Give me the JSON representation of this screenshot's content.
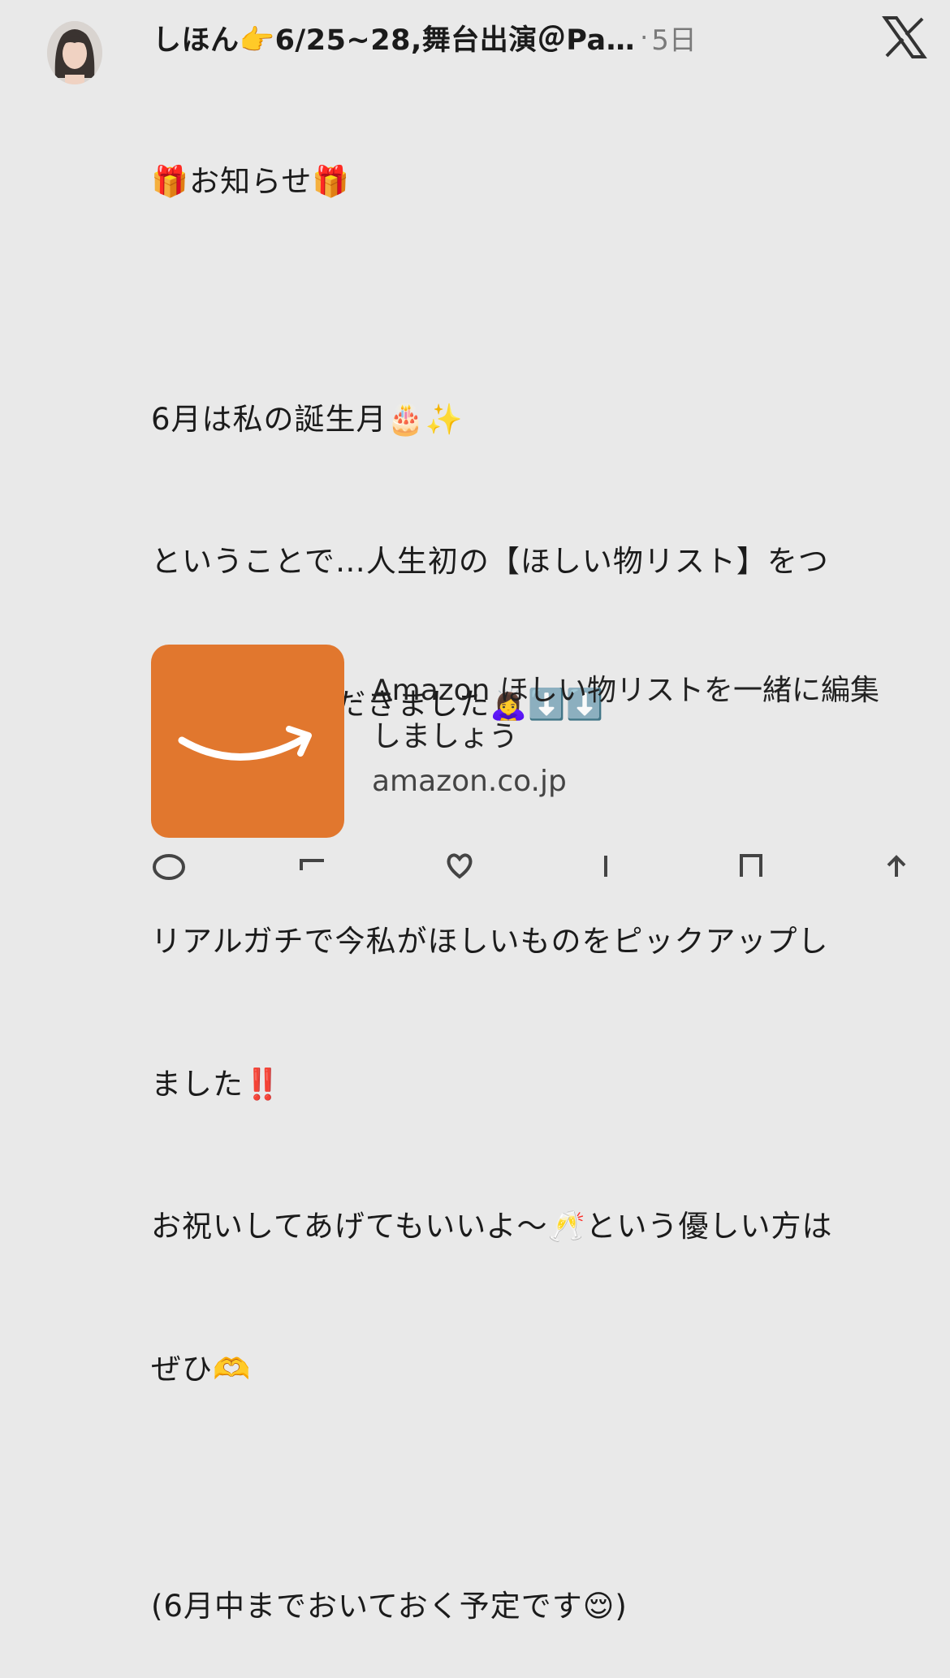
{
  "post": {
    "author": "しほん👉6/25~28,舞台出演＠Pa…",
    "separator": "·",
    "time": "5日",
    "lines": [
      "🎁お知らせ🎁",
      "",
      "6月は私の誕生月🎂✨",
      "ということで…人生初の【ほしい物リスト】をつ",
      "くらせていただきました🙇‍♀️⬇️⬇️",
      "",
      "リアルガチで今私がほしいものをピックアップし",
      "ました‼️",
      "お祝いしてあげてもいいよ〜🥂という優しい方は",
      "ぜひ🫶",
      "",
      "(6月中までおいておく予定です😌)"
    ]
  },
  "link_card": {
    "title": "Amazon ほしい物リストを一緒に編集しましょう",
    "domain": "amazon.co.jp",
    "thumb_color": "#e1772e"
  },
  "icons": {
    "platform": "x-logo-icon",
    "avatar": "avatar"
  },
  "colors": {
    "background": "#e9e9e9",
    "text": "#1b1b1b",
    "muted": "#7a7a7a"
  }
}
